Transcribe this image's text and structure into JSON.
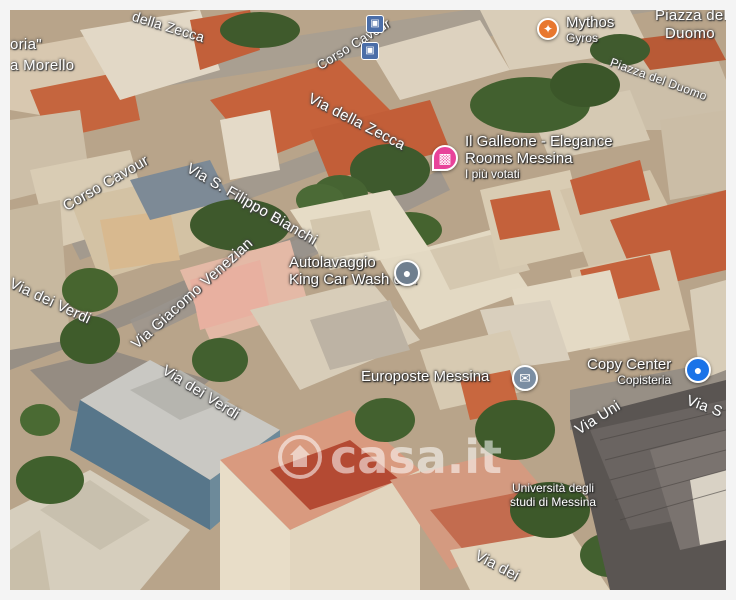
{
  "map": {
    "streets": [
      {
        "label": "della Zecca"
      },
      {
        "label": "Corso Cavour"
      },
      {
        "label": "Via della Zecca"
      },
      {
        "label": "Piazza del Duomo"
      },
      {
        "label": "Corso Cavour"
      },
      {
        "label": "Via S. Filippo Bianchi"
      },
      {
        "label": "Via dei Verdi"
      },
      {
        "label": "Via Giacomo Venezian"
      },
      {
        "label": "Via dei Verdi"
      },
      {
        "label": "Via Uni"
      },
      {
        "label": "Via S"
      },
      {
        "label": "Via dei"
      }
    ],
    "edge_labels": [
      {
        "label": "oria\""
      },
      {
        "label": "a Morello"
      },
      {
        "label": "Piazza del"
      },
      {
        "label": "Duomo"
      }
    ],
    "places": [
      {
        "name": "Mythos",
        "sub": "Gyros",
        "icon": "restaurant-icon",
        "color": "#e8772e"
      },
      {
        "name": "Il Galleone - Elegance",
        "name2": "Rooms Messina",
        "sub": "I più votati",
        "icon": "hotel-icon",
        "color": "#e8439a"
      },
      {
        "name": "Autolavaggio",
        "name2": "King Car Wash di...",
        "icon": "location-icon",
        "color": "#6f7f8f"
      },
      {
        "name": "Europoste Messina",
        "icon": "mail-icon",
        "color": "#7b8ea3"
      },
      {
        "name": "Copy Center",
        "sub": "Copisteria",
        "icon": "lock-icon",
        "color": "#1a73e8"
      },
      {
        "name": "Università degli",
        "name2": "studi di Messina"
      }
    ],
    "watermark": "casa.it"
  }
}
